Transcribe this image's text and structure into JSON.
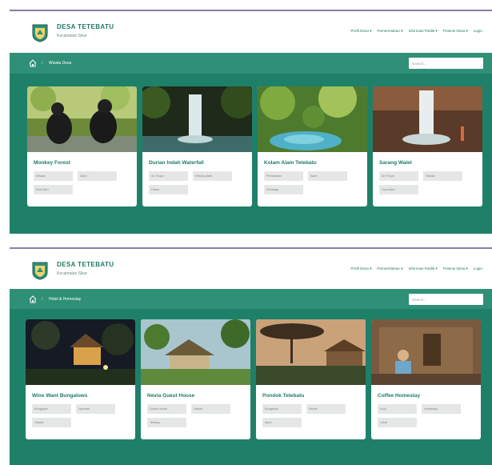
{
  "site": {
    "title": "DESA TETEBATU",
    "subtitle": "Kecamatan Sikur"
  },
  "nav": {
    "items": [
      "Profil Desa ▾",
      "Pemerintahan ▾",
      "Informasi Publik ▾",
      "Potensi Desa ▾",
      "Login"
    ]
  },
  "search": {
    "placeholder": "Search..."
  },
  "colors": {
    "brand": "#1e7a66",
    "bar": "#2f8f77",
    "content": "#1f8069"
  },
  "icons": {
    "home": "home-icon",
    "logo": "shield-logo-icon"
  },
  "screens": [
    {
      "breadcrumb": "Wisata Desa",
      "cards": [
        {
          "title": "Monkey Forest",
          "tags": [
            "Wisata",
            "Alam",
            "Kera Abu"
          ],
          "photo": "monkeys"
        },
        {
          "title": "Durian Indah Waterfall",
          "tags": [
            "Air Terjun",
            "Wisata Alam",
            "Hutan"
          ],
          "photo": "waterfall"
        },
        {
          "title": "Kolam Alam Tetebatu",
          "tags": [
            "Pemandian",
            "Alam",
            "Keluarga"
          ],
          "photo": "pool"
        },
        {
          "title": "Sarang Walet",
          "tags": [
            "Air Terjun",
            "Wisata",
            "Gua Alam"
          ],
          "photo": "cave"
        }
      ]
    },
    {
      "breadcrumb": "Hotel & Homestay",
      "cards": [
        {
          "title": "Wine Want Bungalows",
          "tags": [
            "Bungalow",
            "Nyaman",
            "Sawah"
          ],
          "photo": "bungalow-night"
        },
        {
          "title": "Nevia Guest House",
          "tags": [
            "Guest House",
            "Sawah",
            "Tenang"
          ],
          "photo": "guesthouse"
        },
        {
          "title": "Pondok Tetebatu",
          "tags": [
            "Bungalow",
            "Murah",
            "Alam"
          ],
          "photo": "pondok"
        },
        {
          "title": "Coffee Homestay",
          "tags": [
            "Kopi",
            "Homestay",
            "Lokal"
          ],
          "photo": "homestay"
        }
      ]
    }
  ]
}
